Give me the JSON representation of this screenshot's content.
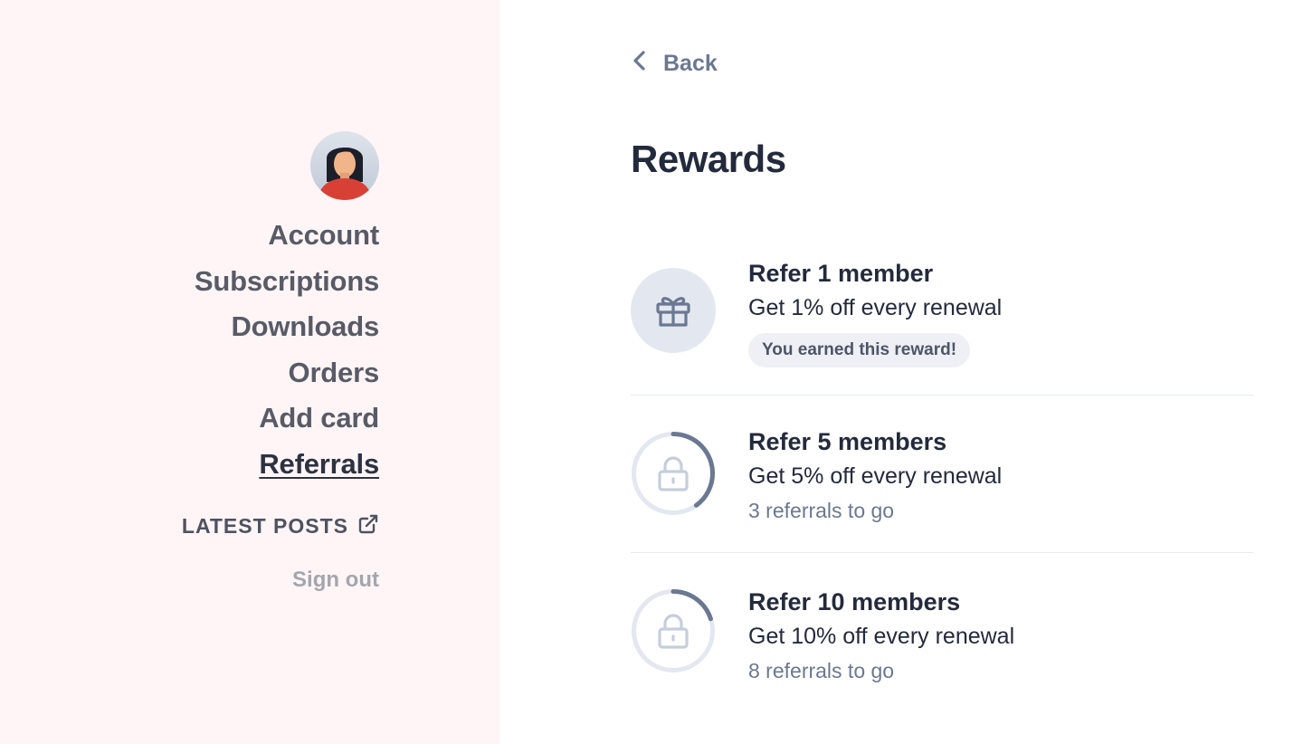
{
  "sidebar": {
    "avatar_alt": "User avatar",
    "nav": [
      {
        "label": "Account",
        "active": false
      },
      {
        "label": "Subscriptions",
        "active": false
      },
      {
        "label": "Downloads",
        "active": false
      },
      {
        "label": "Orders",
        "active": false
      },
      {
        "label": "Add card",
        "active": false
      },
      {
        "label": "Referrals",
        "active": true
      }
    ],
    "latest_posts": "LATEST POSTS",
    "latest_posts_icon": "external-link-icon",
    "sign_out": "Sign out"
  },
  "main": {
    "back_label": "Back",
    "title": "Rewards",
    "rewards": [
      {
        "title": "Refer 1 member",
        "description": "Get 1% off every renewal",
        "status": "You earned this reward!",
        "icon": "gift-icon",
        "earned": true
      },
      {
        "title": "Refer 5 members",
        "description": "Get 5% off every renewal",
        "status": "3 referrals to go",
        "icon": "lock-icon",
        "earned": false,
        "progress": 0.4
      },
      {
        "title": "Refer 10 members",
        "description": "Get 10% off every renewal",
        "status": "8 referrals to go",
        "icon": "lock-icon",
        "earned": false,
        "progress": 0.2
      }
    ]
  },
  "colors": {
    "sidebar_bg": "#fff5f6",
    "text_dark": "#232a3b",
    "muted_blue": "#6b7891",
    "ring_track": "#e3e8f0",
    "ring_progress": "#6b7891"
  }
}
